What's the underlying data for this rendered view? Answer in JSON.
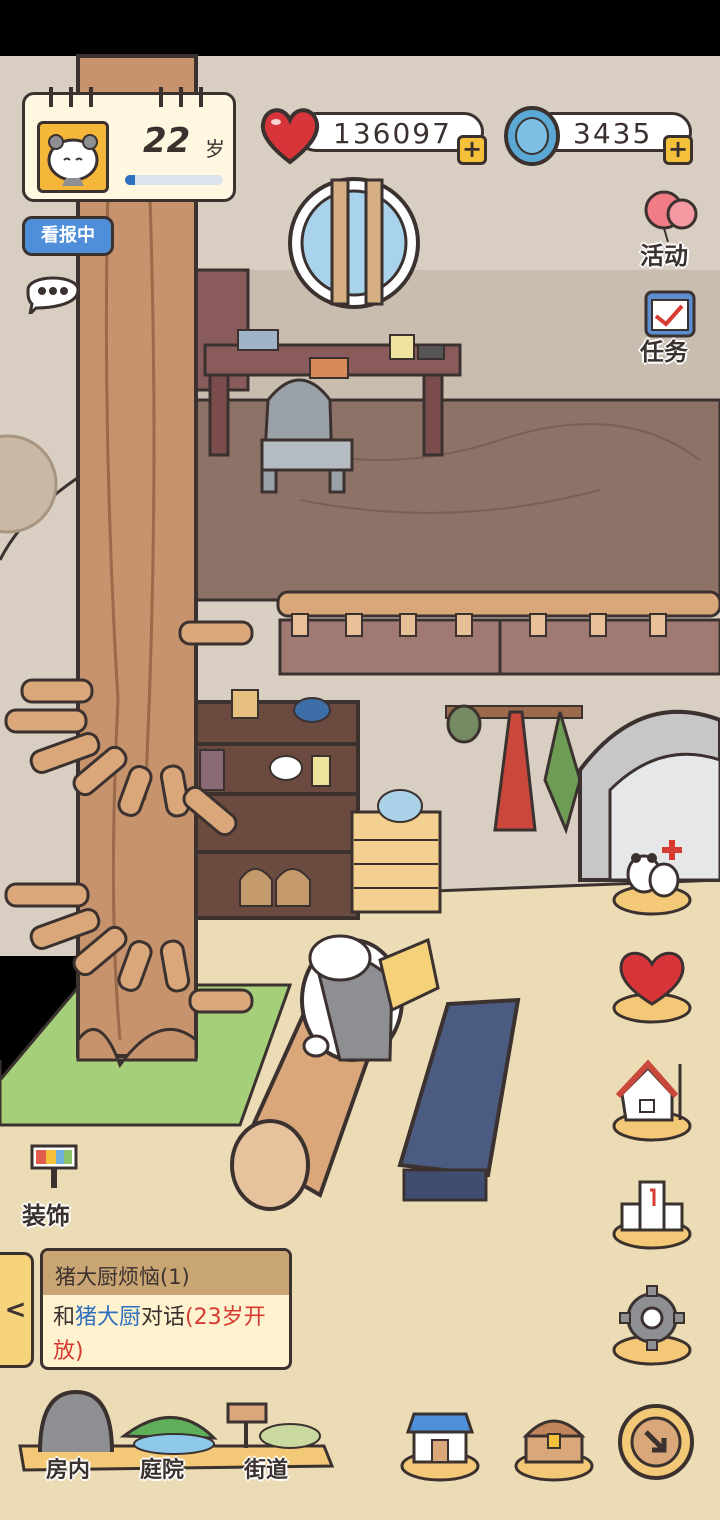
{
  "profile": {
    "age_value": "22",
    "age_unit": "岁",
    "age_progress": 0.1
  },
  "currency": {
    "hearts": "136097",
    "coins": "3435",
    "plus": "+"
  },
  "status": {
    "badge": "看报中"
  },
  "side_menu": {
    "activity_label": "活动",
    "tasks_label": "任务",
    "decorate_label": "装饰"
  },
  "quest": {
    "title": "猪大厨烦恼(1)",
    "body_prefix": "和",
    "npc": "猪大厨",
    "body_action": "对话",
    "requirement": "(23岁开放)",
    "toggle": "<"
  },
  "bottom_nav": {
    "indoor": "房内",
    "yard": "庭院",
    "street": "街道"
  },
  "colors": {
    "wall": "#d8cec2",
    "floor": "#ecdcb6",
    "outline": "#3b3230",
    "accent_blue": "#2e6fbf",
    "accent_red": "#d63a31",
    "gold": "#f5c03a"
  }
}
